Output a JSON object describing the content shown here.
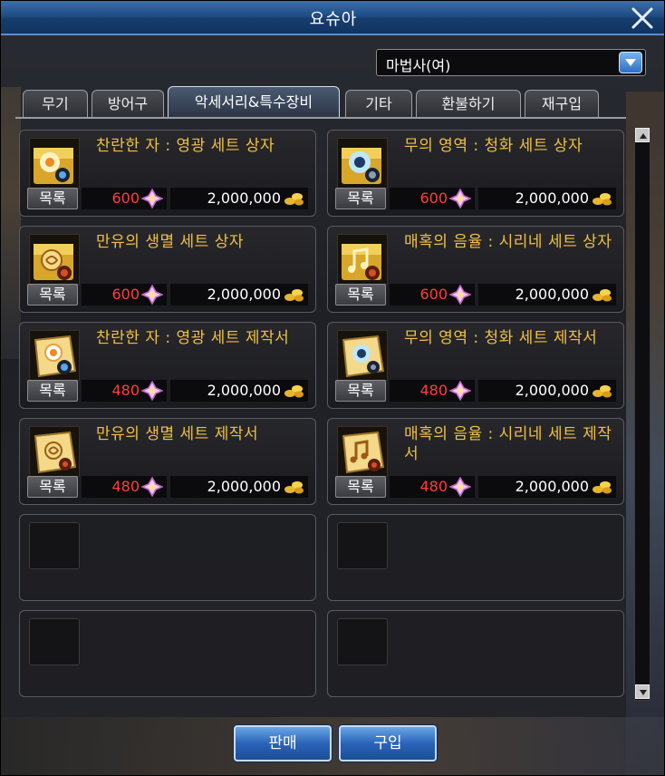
{
  "window": {
    "title": "요슈아",
    "close_icon": "close-icon"
  },
  "class_select": {
    "value": "마법사(여)",
    "icon": "chevron-down-icon"
  },
  "tabs": [
    {
      "label": "무기",
      "active": false
    },
    {
      "label": "방어구",
      "active": false
    },
    {
      "label": "악세서리&특수장비",
      "active": true
    },
    {
      "label": "기타",
      "active": false
    },
    {
      "label": "환불하기",
      "active": false
    },
    {
      "label": "재구입",
      "active": false
    }
  ],
  "items": [
    {
      "name": "찬란한 자 : 영광 세트 상자",
      "list_label": "목록",
      "points": "600",
      "gold": "2,000,000",
      "icon": "sun-box-icon"
    },
    {
      "name": "무의 영역 : 청화 세트 상자",
      "list_label": "목록",
      "points": "600",
      "gold": "2,000,000",
      "icon": "eye-box-icon"
    },
    {
      "name": "만유의 생멸 세트 상자",
      "list_label": "목록",
      "points": "600",
      "gold": "2,000,000",
      "icon": "swirl-box-icon"
    },
    {
      "name": "매혹의 음율 : 시리네 세트 상자",
      "list_label": "목록",
      "points": "600",
      "gold": "2,000,000",
      "icon": "music-box-icon"
    },
    {
      "name": "찬란한 자 : 영광 세트 제작서",
      "list_label": "목록",
      "points": "480",
      "gold": "2,000,000",
      "icon": "sun-scroll-icon"
    },
    {
      "name": "무의 영역 : 청화 세트 제작서",
      "list_label": "목록",
      "points": "480",
      "gold": "2,000,000",
      "icon": "eye-scroll-icon"
    },
    {
      "name": "만유의 생멸 세트 제작서",
      "list_label": "목록",
      "points": "480",
      "gold": "2,000,000",
      "icon": "swirl-scroll-icon"
    },
    {
      "name": "매혹의 음율 : 시리네 세트 제작서",
      "list_label": "목록",
      "points": "480",
      "gold": "2,000,000",
      "icon": "music-scroll-icon"
    }
  ],
  "buttons": {
    "sell": "판매",
    "buy": "구입"
  },
  "colors": {
    "item_name": "#f0c040",
    "points": "#ff3c3c",
    "title_bar": "#1f4d86"
  }
}
